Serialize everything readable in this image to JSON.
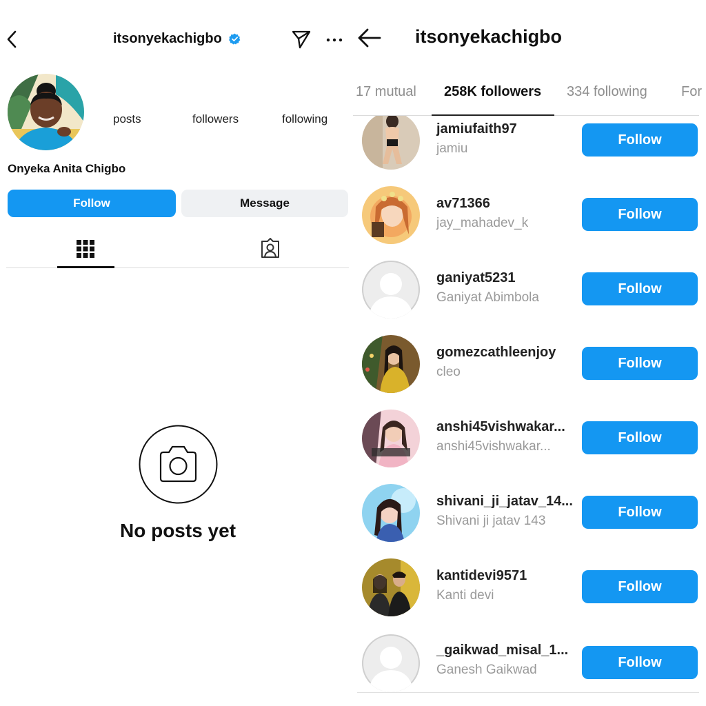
{
  "left": {
    "header": {
      "username": "itsonyekachigbo"
    },
    "profile": {
      "stats": [
        {
          "label": "posts"
        },
        {
          "label": "followers"
        },
        {
          "label": "following"
        }
      ],
      "full_name": "Onyeka Anita Chigbo"
    },
    "actions": {
      "follow_label": "Follow",
      "message_label": "Message"
    },
    "empty_state": {
      "text": "No posts yet"
    }
  },
  "right": {
    "header": {
      "username": "itsonyekachigbo"
    },
    "tabs": [
      {
        "label": "17 mutual"
      },
      {
        "label": "258K followers"
      },
      {
        "label": "334 following"
      },
      {
        "label": "For"
      }
    ],
    "followers": [
      {
        "username": "jamiufaith97",
        "name": "jamiu",
        "button": "Follow"
      },
      {
        "username": "av71366",
        "name": "jay_mahadev_k",
        "button": "Follow"
      },
      {
        "username": "ganiyat5231",
        "name": "Ganiyat Abimbola",
        "button": "Follow"
      },
      {
        "username": "gomezcathleenjoy",
        "name": "cleo",
        "button": "Follow"
      },
      {
        "username": "anshi45vishwakar...",
        "name": "anshi45vishwakar...",
        "button": "Follow"
      },
      {
        "username": "shivani_ji_jatav_14...",
        "name": "Shivani ji jatav 143",
        "button": "Follow"
      },
      {
        "username": "kantidevi9571",
        "name": "Kanti devi",
        "button": "Follow"
      },
      {
        "username": "_gaikwad_misal_1...",
        "name": "Ganesh Gaikwad",
        "button": "Follow"
      }
    ]
  },
  "colors": {
    "accent": "#1497f2",
    "secondary_button": "#eff1f3",
    "muted_text": "#9a9a9a",
    "verified": "#1d9bf0"
  }
}
